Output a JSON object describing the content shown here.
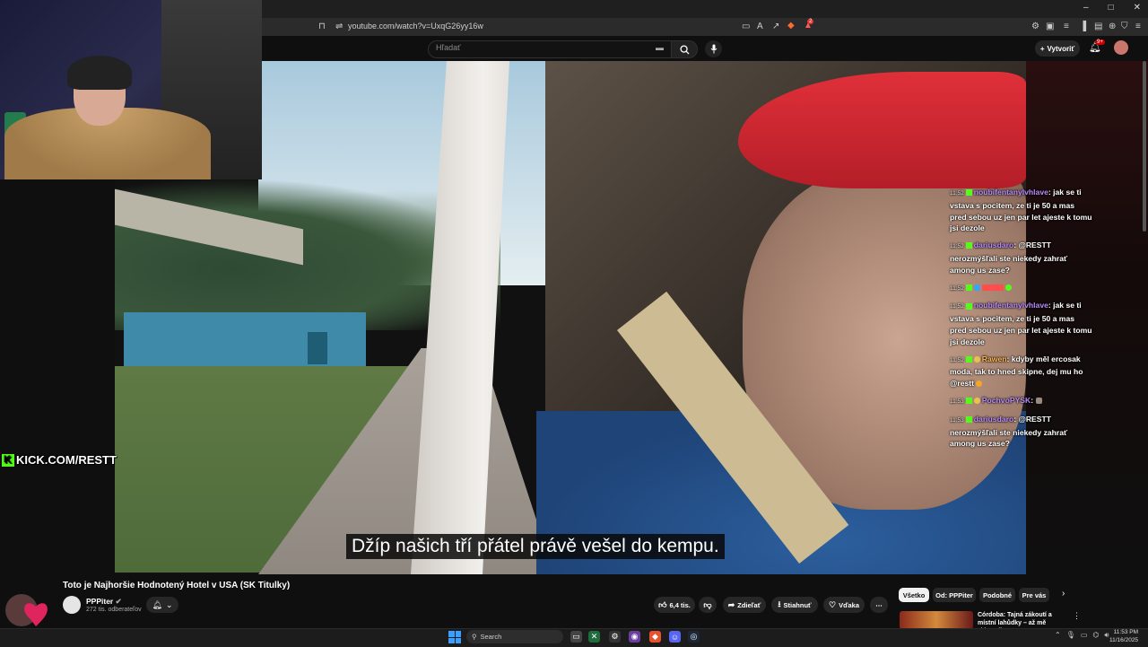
{
  "browser": {
    "url": "youtube.com/watch?v=UxqG26yy16w",
    "window_controls": [
      "–",
      "□",
      "✕"
    ],
    "notification_count": "2"
  },
  "youtube": {
    "search_placeholder": "Hľadať",
    "create_label": "Vytvoriť",
    "bell_badge": "9+",
    "video": {
      "subtitle": "Džíp našich tří přátel právě vešel do kempu.",
      "title": "Toto je Najhoršie Hodnotený Hotel v USA (SK Titulky)",
      "channel": "PPPiter",
      "subscribers": "272 tis. odberateľov",
      "likes": "6,4 tis.",
      "share_label": "Zdieľať",
      "download_label": "Stiahnuť",
      "thanks_label": "Vďaka",
      "more_label": "⋯"
    },
    "chips": [
      "Všetko",
      "Od: PPPiter",
      "Podobné",
      "Pre vás"
    ],
    "recommended": {
      "title": "Córdoba: Tajná zákoutí a místní lahůdky – až mě zklamali"
    }
  },
  "overlay": {
    "kick_text": "KICK.COM/RESTT",
    "chat": [
      {
        "time": "11:52",
        "user": "noubifentanylvhlave",
        "user_color": "#b98cff",
        "text": "jak se ti vstava s pocitem, ze ti je 50 a mas pred sebou uz jen par let ajeste k tomu jsi dezole"
      },
      {
        "time": "11:52",
        "user": "dariusdaro",
        "user_color": "#b98cff",
        "text": "@RESTT nerozmýšľali ste niekedy zahrať among us zase?"
      },
      {
        "time": "11:52",
        "user": "",
        "user_color": "#ff4d4d",
        "text": ""
      },
      {
        "time": "11:52",
        "user": "noubifentanylvhlave",
        "user_color": "#b98cff",
        "text": "jak se ti vstava s pocitem, ze ti je 50 a mas pred sebou uz jen par let ajeste k tomu jsi dezole"
      },
      {
        "time": "11:52",
        "user": "Rawen",
        "user_color": "#ffb74d",
        "text": "kdyby měl ercosak moda, tak to hned skipne, dej mu ho @restt"
      },
      {
        "time": "11:53",
        "user": "PochvoPYSK",
        "user_color": "#b98cff",
        "text": ""
      },
      {
        "time": "11:53",
        "user": "dariusdaro",
        "user_color": "#b98cff",
        "text": "@RESTT nerozmýšľali ste niekedy zahrať among us zase?"
      }
    ]
  },
  "taskbar": {
    "search_label": "Search",
    "time": "11:53 PM",
    "date": "11/16/2025"
  }
}
